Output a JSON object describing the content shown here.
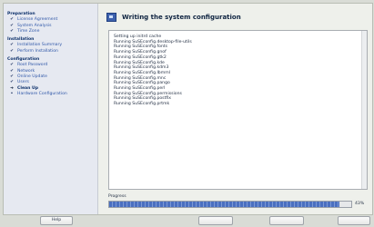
{
  "steps": {
    "groups": [
      {
        "title": "Preparation",
        "items": [
          {
            "label": "License Agreement",
            "state": "done"
          },
          {
            "label": "System Analysis",
            "state": "done"
          },
          {
            "label": "Time Zone",
            "state": "done"
          }
        ]
      },
      {
        "title": "Installation",
        "items": [
          {
            "label": "Installation Summary",
            "state": "done"
          },
          {
            "label": "Perform Installation",
            "state": "done"
          }
        ]
      },
      {
        "title": "Configuration",
        "items": [
          {
            "label": "Root Password",
            "state": "done"
          },
          {
            "label": "Network",
            "state": "done"
          },
          {
            "label": "Online Update",
            "state": "done"
          },
          {
            "label": "Users",
            "state": "done"
          },
          {
            "label": "Clean Up",
            "state": "current"
          },
          {
            "label": "Hardware Configuration",
            "state": "pending"
          }
        ]
      }
    ]
  },
  "dialog": {
    "title": "Writing the system configuration"
  },
  "log_lines": [
    "Setting up initrd cache",
    "Running SuSEconfig.desktop-file-utils",
    "Running SuSEconfig.fonts",
    "Running SuSEconfig.gnof",
    "Running SuSEconfig.gtk2",
    "Running SuSEconfig.kde",
    "Running SuSEconfig.kdm3",
    "Running SuSEconfig.Ibmml",
    "Running SuSEconfig.mnc",
    "Running SuSEconfig.pango",
    "Running SuSEconfig.perl",
    "Running SuSEconfig.permissions",
    "Running SuSEconfig.postfix",
    "Running SuSEconfig.prtmk"
  ],
  "progress": {
    "label": "Progress",
    "percent_text": "43%",
    "fraction": 0.95
  },
  "buttons": {
    "help": "Help"
  }
}
